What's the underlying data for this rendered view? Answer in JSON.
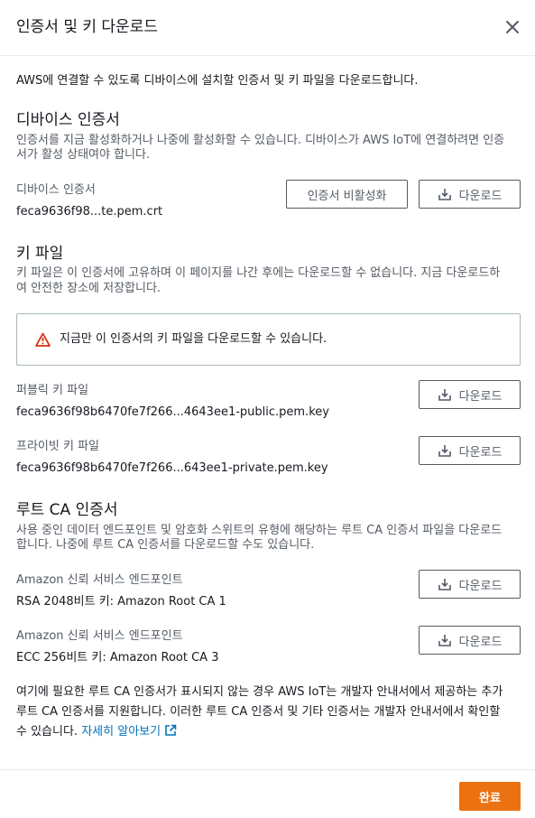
{
  "modal": {
    "title": "인증서 및 키 다운로드",
    "intro": "AWS에 연결할 수 있도록 디바이스에 설치할 인증서 및 키 파일을 다운로드합니다."
  },
  "device_cert": {
    "title": "디바이스 인증서",
    "desc_line1": "인증서를 지금 활성화하거나 나중에 활성화할 수 있습니다. 디바이스가 AWS IoT에 연결하려면 인증",
    "desc_line2": "서가 활성 상태여야 합니다.",
    "label": "디바이스 인증서",
    "value": "feca9636f98...te.pem.crt",
    "deactivate_label": "인증서 비활성화",
    "download_label": "다운로드"
  },
  "key_files": {
    "title": "키 파일",
    "desc_line1": "키 파일은 이 인증서에 고유하며 이 페이지를 나간 후에는 다운로드할 수 없습니다. 지금 다운로드하",
    "desc_line2": "여 안전한 장소에 저장합니다.",
    "alert": "지금만 이 인증서의 키 파일을 다운로드할 수 있습니다.",
    "public_label": "퍼블릭 키 파일",
    "public_value": "feca9636f98b6470fe7f266...4643ee1-public.pem.key",
    "private_label": "프라이빗 키 파일",
    "private_value": "feca9636f98b6470fe7f266...643ee1-private.pem.key",
    "download_label": "다운로드"
  },
  "root_ca": {
    "title": "루트 CA 인증서",
    "desc_line1": "사용 중인 데이터 엔드포인트 및 암호화 스위트의 유형에 해당하는 루트 CA 인증서 파일을 다운로드",
    "desc_line2": "합니다. 나중에 루트 CA 인증서를 다운로드할 수도 있습니다.",
    "ca1_label": "Amazon 신뢰 서비스 엔드포인트",
    "ca1_value": "RSA 2048비트 키: Amazon Root CA 1",
    "ca3_label": "Amazon 신뢰 서비스 엔드포인트",
    "ca3_value": "ECC 256비트 키: Amazon Root CA 3",
    "download_label": "다운로드"
  },
  "footer_note": {
    "line1": "여기에 필요한 루트 CA 인증서가 표시되지 않는 경우 AWS IoT는 개발자 안내서에서 제공하는 추가",
    "line2": "루트 CA 인증서를 지원합니다. 이러한 루트 CA 인증서 및 기타 인증서는 개발자 안내서에서 확인할",
    "line3": "수 있습니다.",
    "link": "자세히 알아보기"
  },
  "footer": {
    "done_label": "완료"
  },
  "icons": {
    "close": "close-icon",
    "download": "download-icon",
    "warning": "warning-icon",
    "external": "external-link-icon"
  },
  "colors": {
    "primary": "#ec7211",
    "link": "#0073bb",
    "warning": "#d13212",
    "border": "#545b64"
  }
}
